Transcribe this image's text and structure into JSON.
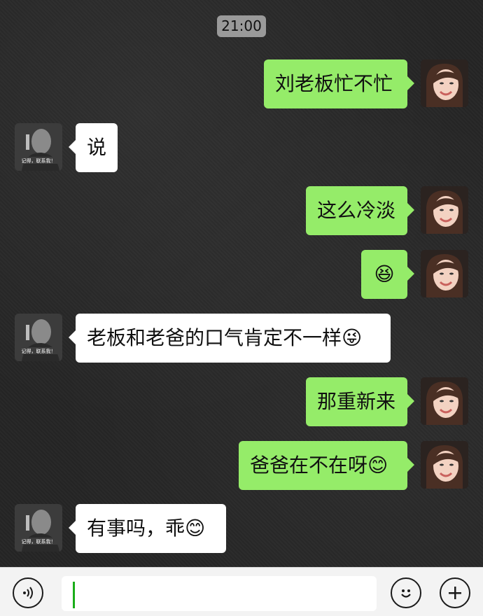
{
  "time_divider": "21:00",
  "messages": [
    {
      "sender": "me",
      "text": "刘老板忙不忙",
      "emoji": ""
    },
    {
      "sender": "them",
      "text": "说",
      "emoji": ""
    },
    {
      "sender": "me",
      "text": "这么冷淡",
      "emoji": ""
    },
    {
      "sender": "me",
      "text": "",
      "emoji": "😆"
    },
    {
      "sender": "them",
      "text": "老板和老爸的口气肯定不一样",
      "emoji": "😜"
    },
    {
      "sender": "me",
      "text": "那重新来",
      "emoji": ""
    },
    {
      "sender": "me",
      "text": "爸爸在不在呀",
      "emoji": "😊"
    },
    {
      "sender": "them",
      "text": "有事吗，乖",
      "emoji": "😊"
    }
  ],
  "contact_avatar": {
    "caption": "记得，联系我！"
  },
  "input_bar": {
    "value": "",
    "icons": [
      "voice-icon",
      "emoji-icon",
      "plus-icon"
    ]
  },
  "colors": {
    "my_bubble": "#95ec69",
    "their_bubble": "#ffffff",
    "background": "#252525",
    "time_badge": "#9a9a9a"
  }
}
